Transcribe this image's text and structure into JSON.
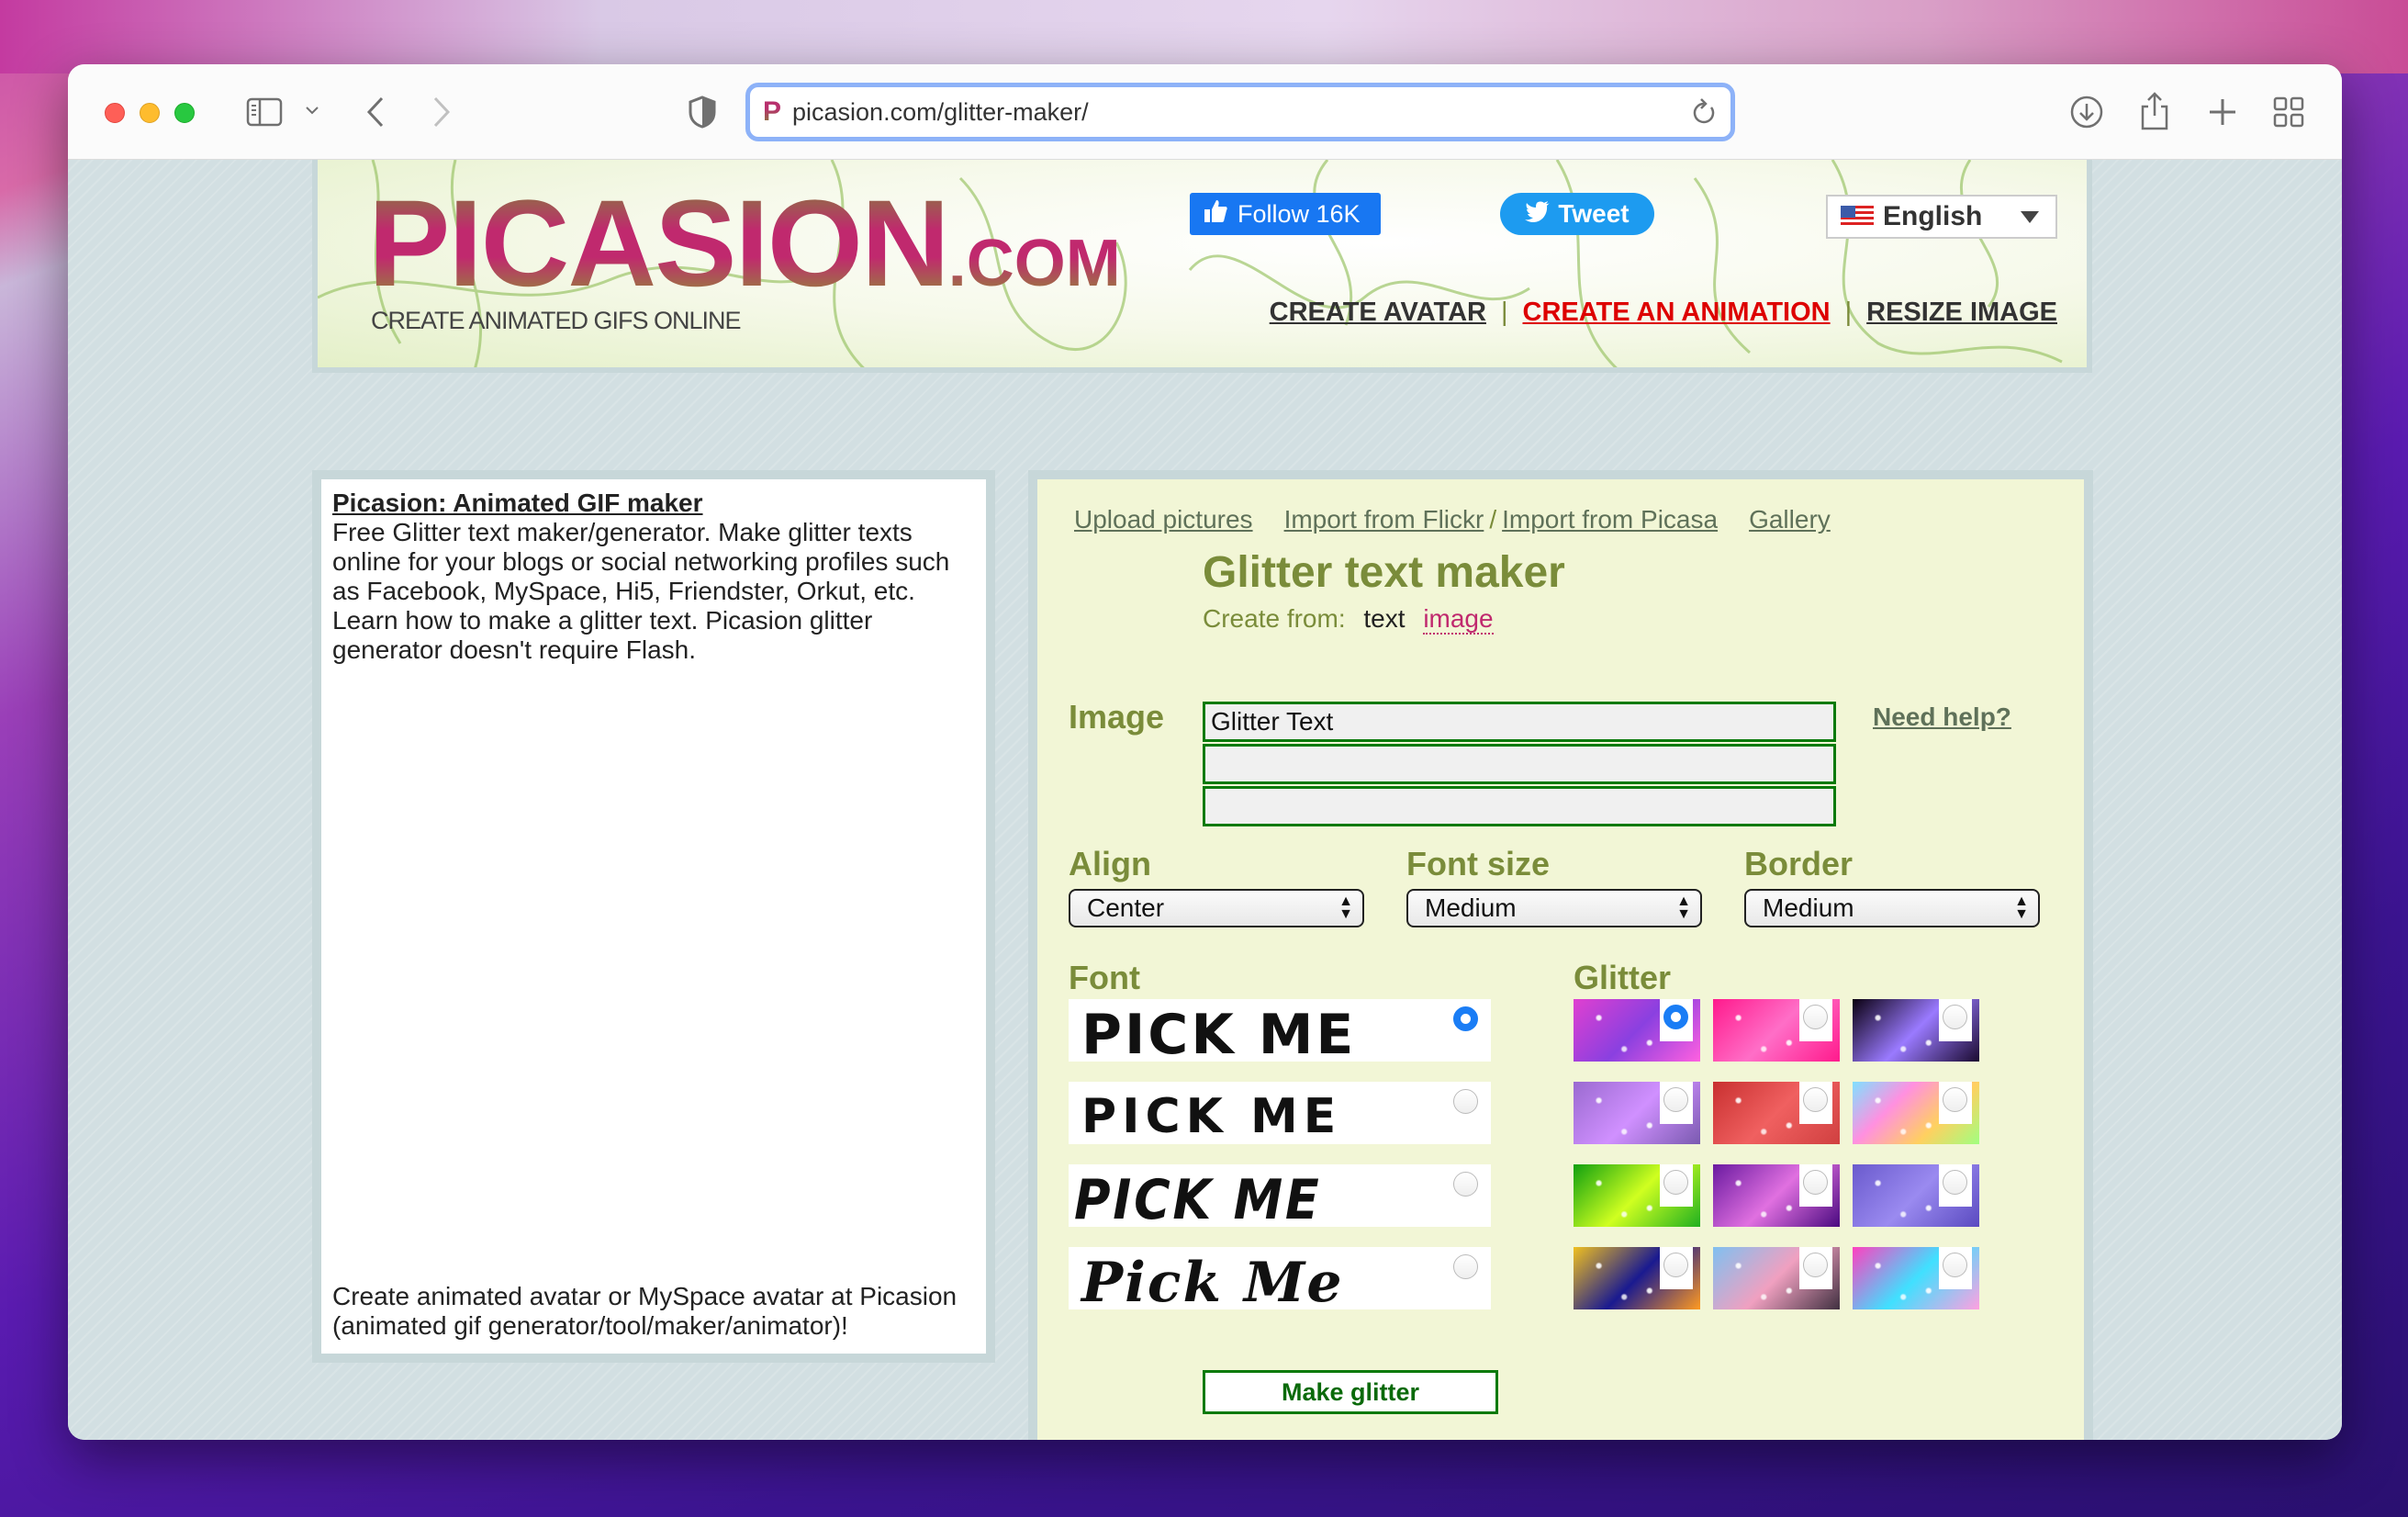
{
  "browser": {
    "url": "picasion.com/glitter-maker/",
    "favicon_letter": "P",
    "icons": [
      "sidebar-icon",
      "chevron-down-icon",
      "back-icon",
      "forward-icon",
      "shield-icon",
      "reload-icon",
      "download-icon",
      "share-icon",
      "new-tab-icon",
      "tab-overview-icon"
    ]
  },
  "header": {
    "logo_main": "PICASION",
    "logo_suffix": ".COM",
    "tagline": "CREATE ANIMATED GIFS ONLINE",
    "facebook_label": "Follow 16K",
    "twitter_label": "Tweet",
    "language": "English",
    "nav": [
      {
        "label": "CREATE AVATAR",
        "active": false
      },
      {
        "label": "CREATE AN ANIMATION",
        "active": true
      },
      {
        "label": "RESIZE IMAGE",
        "active": false
      }
    ],
    "nav_separator": "|"
  },
  "left_panel": {
    "title": "Picasion: Animated GIF maker",
    "description": "Free Glitter text maker/generator. Make glitter texts online for your blogs or social networking profiles such as Facebook, MySpace, Hi5, Friendster, Orkut, etc. Learn how to make a glitter text. Picasion glitter generator doesn't require Flash.",
    "footer": "Create animated avatar or MySpace avatar at Picasion (animated gif generator/tool/maker/animator)!"
  },
  "main": {
    "links": {
      "upload": "Upload pictures",
      "flickr": "Import from Flickr",
      "slash": "/",
      "picasa": "Import from Picasa",
      "gallery": "Gallery"
    },
    "title": "Glitter text maker",
    "create_from_label": "Create from:",
    "create_from_text": "text",
    "create_from_image": "image",
    "image_label": "Image",
    "text_lines": [
      "Glitter Text",
      "",
      ""
    ],
    "help_link": "Need help?",
    "align": {
      "label": "Align",
      "value": "Center"
    },
    "font_size": {
      "label": "Font size",
      "value": "Medium"
    },
    "border": {
      "label": "Border",
      "value": "Medium"
    },
    "font_label": "Font",
    "fonts": [
      {
        "sample": "PICK ME",
        "selected": true
      },
      {
        "sample": "PICK  ME",
        "selected": false
      },
      {
        "sample": "PICK ME",
        "selected": false
      },
      {
        "sample": "Pick Me",
        "selected": false
      }
    ],
    "glitter_label": "Glitter",
    "glitters": [
      {
        "name": "pink-purple-sparkle",
        "selected": true,
        "colors": [
          "#e040d0",
          "#8a40e0",
          "#ff60e0"
        ]
      },
      {
        "name": "hot-pink-grid",
        "selected": false,
        "colors": [
          "#ff1a8c",
          "#ff6ec7",
          "#ff1a8c"
        ]
      },
      {
        "name": "black-purple-bubbles",
        "selected": false,
        "colors": [
          "#0a0010",
          "#9a7aff",
          "#1a0a30"
        ]
      },
      {
        "name": "lilac-stars",
        "selected": false,
        "colors": [
          "#9a6ad0",
          "#d090ff",
          "#7a5ab0"
        ]
      },
      {
        "name": "red-sparkle",
        "selected": false,
        "colors": [
          "#c83030",
          "#f06060",
          "#d04040"
        ]
      },
      {
        "name": "rainbow-squares",
        "selected": false,
        "colors": [
          "#80e0ff",
          "#ff90e0",
          "#ffd060",
          "#a0ff80"
        ]
      },
      {
        "name": "green-sparkle",
        "selected": false,
        "colors": [
          "#10a010",
          "#d0ff20",
          "#20b020"
        ]
      },
      {
        "name": "purple-circles",
        "selected": false,
        "colors": [
          "#6a1aa0",
          "#e070e0",
          "#4a0a80"
        ]
      },
      {
        "name": "violet-stars",
        "selected": false,
        "colors": [
          "#6a5acd",
          "#9a8af0",
          "#5a4ac0"
        ]
      },
      {
        "name": "gold-blue-swirl",
        "selected": false,
        "colors": [
          "#f0c020",
          "#1a1a90",
          "#ff9a20"
        ]
      },
      {
        "name": "pastel-pebbles",
        "selected": false,
        "colors": [
          "#80c0f0",
          "#f0a0c0",
          "#403040"
        ]
      },
      {
        "name": "neon-burst",
        "selected": false,
        "colors": [
          "#ff40c0",
          "#40e0ff",
          "#ffa0e0"
        ]
      }
    ],
    "submit_label": "Make glitter"
  }
}
